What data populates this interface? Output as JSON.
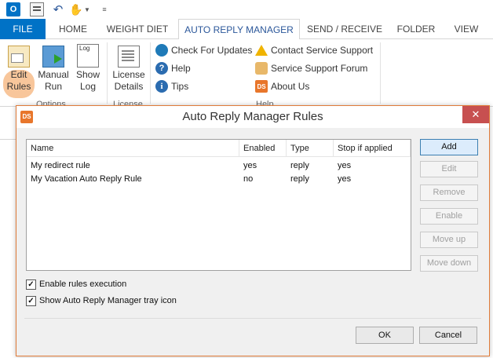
{
  "qat": {
    "logo_icon": "outlook-logo-icon",
    "logo_letter": "O"
  },
  "tabs": [
    {
      "label": "FILE"
    },
    {
      "label": "HOME"
    },
    {
      "label": "WEIGHT DIET"
    },
    {
      "label": "AUTO REPLY MANAGER"
    },
    {
      "label": "SEND / RECEIVE"
    },
    {
      "label": "FOLDER"
    },
    {
      "label": "VIEW"
    }
  ],
  "ribbon": {
    "edit_rules": {
      "line1": "Edit",
      "line2": "Rules"
    },
    "manual_run": {
      "line1": "Manual",
      "line2": "Run"
    },
    "show_log": {
      "line1": "Show",
      "line2": "Log",
      "icon_text": "Log"
    },
    "license_details": {
      "line1": "License",
      "line2": "Details"
    },
    "group_options": "Options",
    "group_license": "License",
    "group_help": "Help",
    "check_updates": "Check For Updates",
    "help": "Help",
    "tips": "Tips",
    "contact_support": "Contact Service Support",
    "support_forum": "Service Support Forum",
    "about_us": "About Us"
  },
  "dialog": {
    "title": "Auto Reply Manager Rules",
    "icon_text": "DS",
    "close_glyph": "✕",
    "columns": [
      "Name",
      "Enabled",
      "Type",
      "Stop if applied"
    ],
    "rows": [
      {
        "name": "My redirect rule",
        "enabled": "yes",
        "type": "reply",
        "stop": "yes"
      },
      {
        "name": "My Vacation Auto Reply Rule",
        "enabled": "no",
        "type": "reply",
        "stop": "yes"
      }
    ],
    "buttons": {
      "add": "Add",
      "edit": "Edit",
      "remove": "Remove",
      "enable": "Enable",
      "move_up": "Move up",
      "move_down": "Move down"
    },
    "checkboxes": {
      "enable_execution": {
        "label": "Enable rules execution",
        "checked": true
      },
      "show_tray": {
        "label": "Show Auto Reply Manager tray icon",
        "checked": true
      }
    },
    "ok": "OK",
    "cancel": "Cancel"
  },
  "colors": {
    "accent": "#0072c6",
    "tab_active_text": "#2b579a",
    "highlight": "#f8c69b",
    "dialog_border": "#e07b39",
    "close_button": "#c75050"
  }
}
